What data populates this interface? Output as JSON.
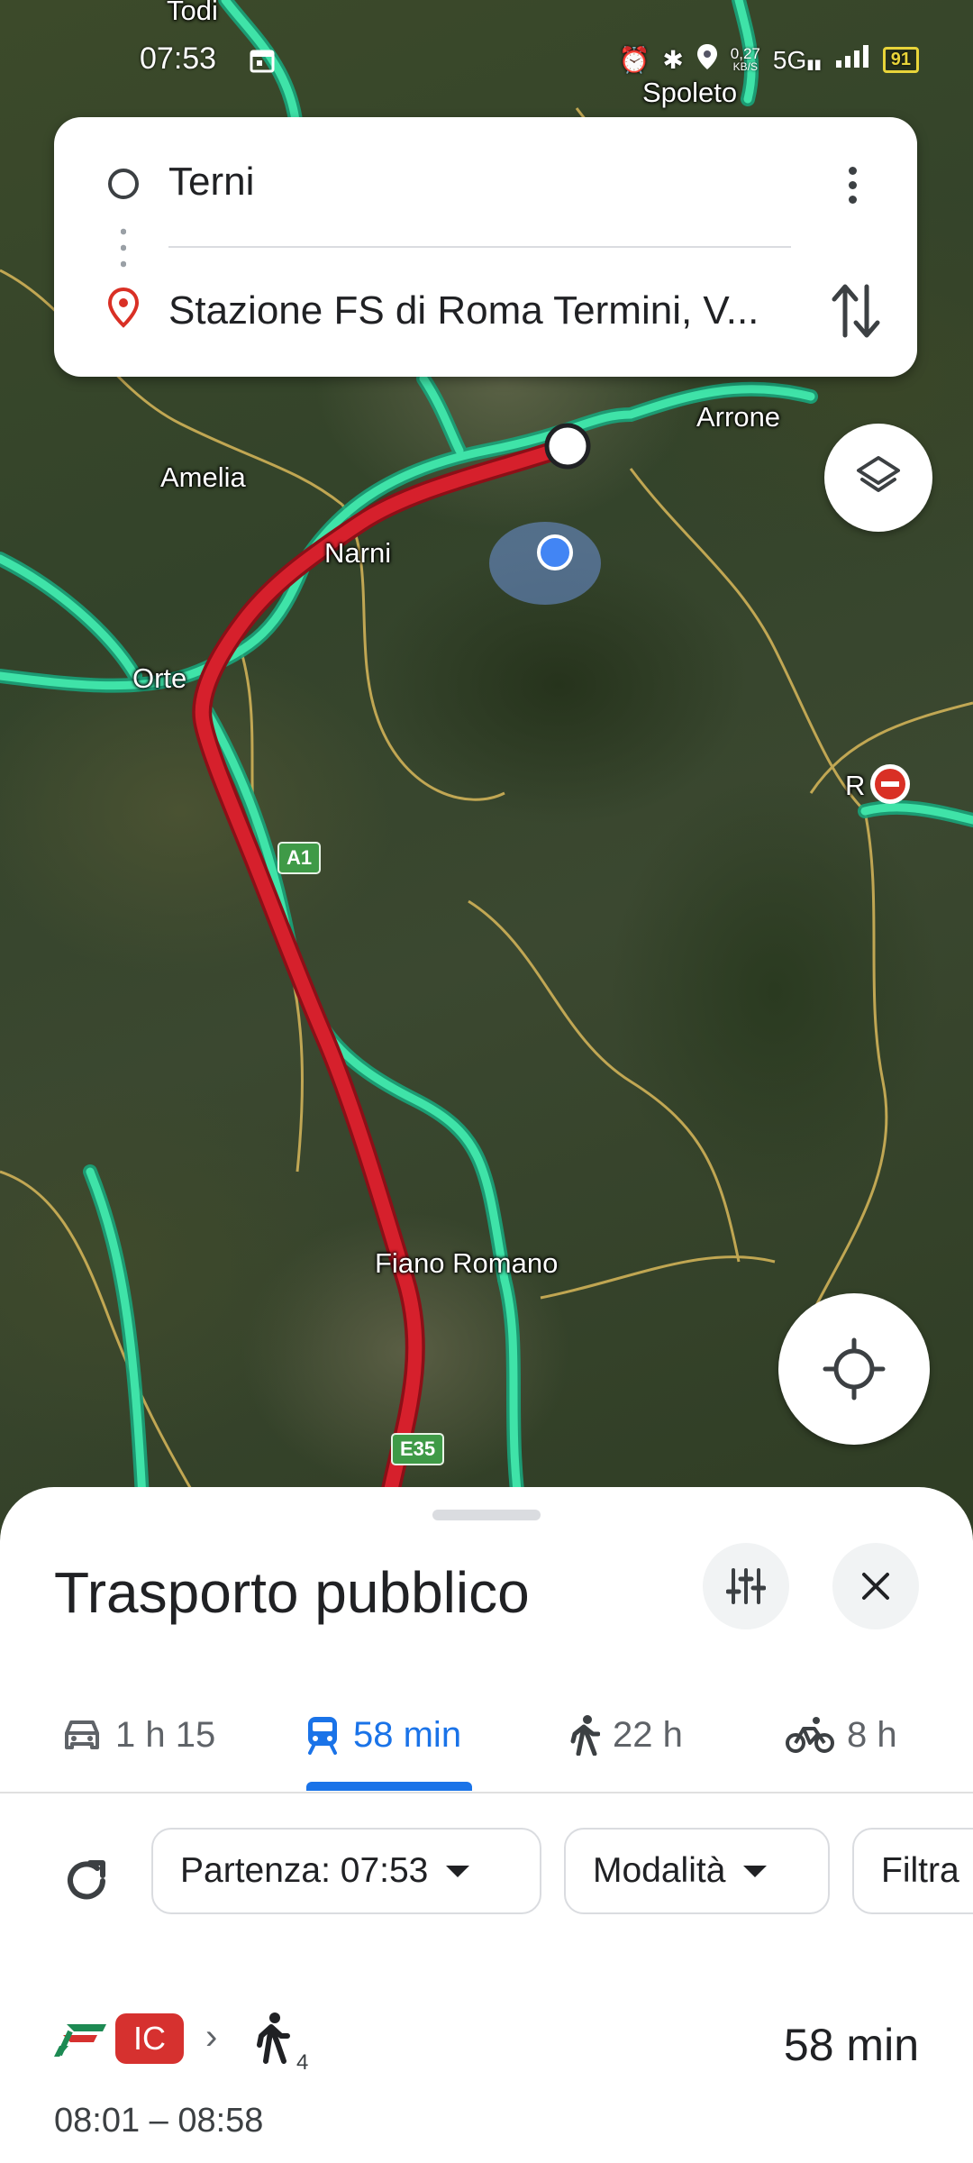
{
  "status_bar": {
    "time": "07:53",
    "net_speed_value": "0,27",
    "net_speed_unit": "KB/S",
    "network": "5G",
    "battery": "91"
  },
  "map": {
    "labels": {
      "todi": "Todi",
      "spoleto": "Spoleto",
      "arrone": "Arrone",
      "amelia": "Amelia",
      "narni": "Narni",
      "orte": "Orte",
      "rieti": "R",
      "fiano_romano": "Fiano Romano"
    },
    "shields": {
      "a1": "A1",
      "e35": "E35"
    },
    "route_color": "#d6202c",
    "road_color": "#2fd49b"
  },
  "directions": {
    "origin": "Terni",
    "destination": "Stazione FS di Roma Termini, V..."
  },
  "sheet": {
    "title": "Trasporto pubblico",
    "modes": [
      {
        "icon": "car-icon",
        "label": "1 h 15",
        "selected": false
      },
      {
        "icon": "transit-icon",
        "label": "58 min",
        "selected": true
      },
      {
        "icon": "walk-icon",
        "label": "22 h",
        "selected": false
      },
      {
        "icon": "bike-icon",
        "label": "8 h",
        "selected": false
      }
    ],
    "chips": {
      "departure": "Partenza: 07:53",
      "modes": "Modalità",
      "filter": "Filtra"
    },
    "route": {
      "train_badge": "IC",
      "walk_minutes": "4",
      "duration": "58 min",
      "times": "08:01 – 08:58"
    }
  },
  "colors": {
    "accent": "#1a73e8",
    "ic_badge": "#d6312f"
  }
}
